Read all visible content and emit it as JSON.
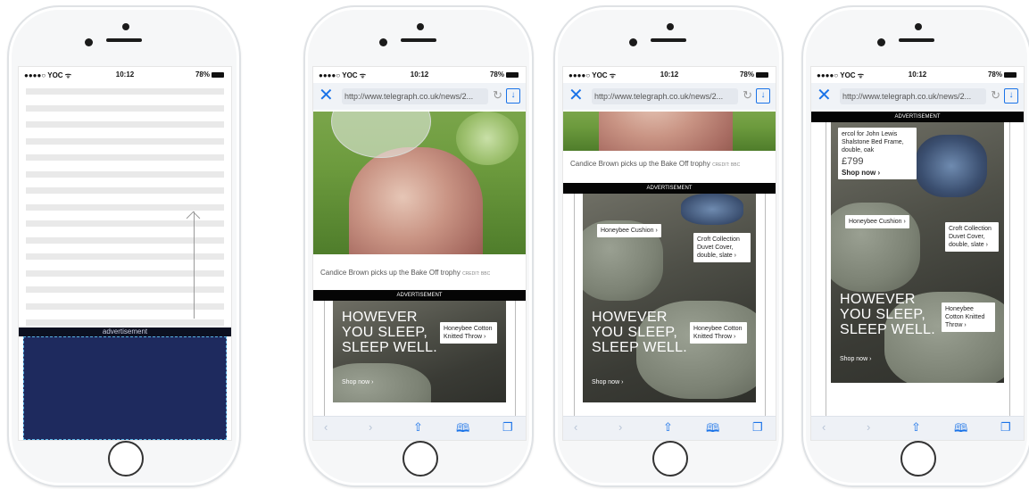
{
  "status_bar": {
    "carrier": "●●●●○ YOC ᯤ",
    "time": "10:12",
    "battery": "78%"
  },
  "browser": {
    "url": "http://www.telegraph.co.uk/news/2..."
  },
  "phone1": {
    "ad_label": "advertisement"
  },
  "article": {
    "caption": "Candice Brown picks up the Bake Off trophy",
    "credit": "CREDIT: BBC"
  },
  "ad": {
    "label": "ADVERTISEMENT",
    "headline_1": "HOWEVER",
    "headline_2": "YOU SLEEP,",
    "headline_3": "SLEEP WELL.",
    "shop_now": "Shop now ›",
    "tag_throw": "Honeybee Cotton Knitted Throw ›",
    "tag_cushion": "Honeybee Cushion ›",
    "tag_duvet": "Croft Collection Duvet Cover, double, slate ›",
    "tag_bed": "ercol for John Lewis Shalstone Bed Frame, double, oak",
    "tag_bed_price": "£799",
    "tag_bed_shop": "Shop now ›"
  },
  "toolbar": {
    "back": "‹",
    "forward": "›",
    "share": "⇧",
    "bookmarks": "🕮",
    "tabs": "❐"
  },
  "colors": {
    "ad_block": "#1e2a5e",
    "dashed_border": "#5ab4e6",
    "ios_blue": "#1a73e8"
  }
}
